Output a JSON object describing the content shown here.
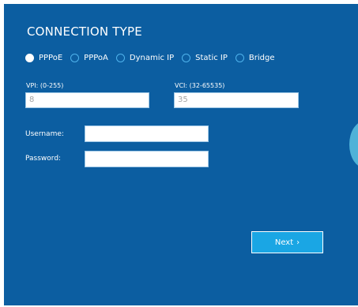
{
  "title": "CONNECTION TYPE",
  "connection_types": [
    {
      "label": "PPPoE",
      "selected": true
    },
    {
      "label": "PPPoA",
      "selected": false
    },
    {
      "label": "Dynamic IP",
      "selected": false
    },
    {
      "label": "Static IP",
      "selected": false
    },
    {
      "label": "Bridge",
      "selected": false
    }
  ],
  "vpi": {
    "label": "VPI: (0-255)",
    "value": "8"
  },
  "vci": {
    "label": "VCI: (32-65535)",
    "value": "35"
  },
  "username": {
    "label": "Username:",
    "value": ""
  },
  "password": {
    "label": "Password:",
    "value": ""
  },
  "next_button": {
    "label": "Next",
    "chevron": "›"
  },
  "colors": {
    "panel": "#0c5ea1",
    "accent": "#1aa6e4",
    "radio_border": "#4fb3ec"
  }
}
